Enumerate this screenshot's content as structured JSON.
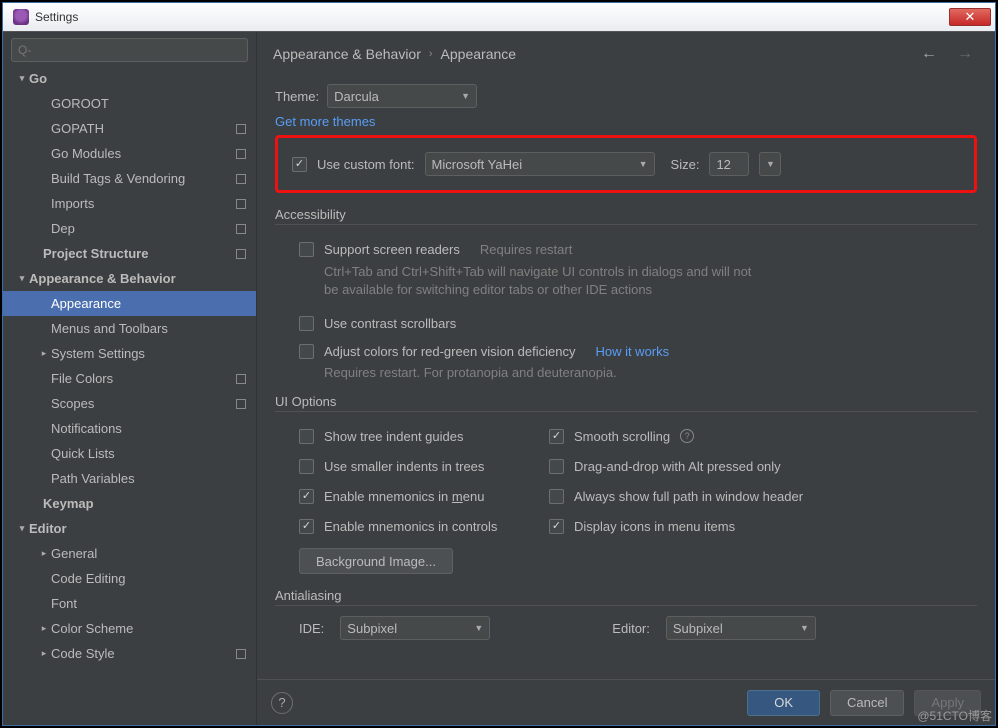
{
  "window": {
    "title": "Settings"
  },
  "search": {
    "placeholder": "Q-"
  },
  "breadcrumb": {
    "parent": "Appearance & Behavior",
    "current": "Appearance"
  },
  "sidebar": [
    {
      "label": "Go",
      "indent": 0,
      "bold": true,
      "chev": "down",
      "badge": false
    },
    {
      "label": "GOROOT",
      "indent": 1,
      "bold": false,
      "chev": "",
      "badge": false
    },
    {
      "label": "GOPATH",
      "indent": 1,
      "bold": false,
      "chev": "",
      "badge": true
    },
    {
      "label": "Go Modules",
      "indent": 1,
      "bold": false,
      "chev": "",
      "badge": true
    },
    {
      "label": "Build Tags & Vendoring",
      "indent": 1,
      "bold": false,
      "chev": "",
      "badge": true
    },
    {
      "label": "Imports",
      "indent": 1,
      "bold": false,
      "chev": "",
      "badge": true
    },
    {
      "label": "Dep",
      "indent": 1,
      "bold": false,
      "chev": "",
      "badge": true
    },
    {
      "label": "Project Structure",
      "indent": 0,
      "bold": true,
      "chev": "",
      "badge": true
    },
    {
      "label": "Appearance & Behavior",
      "indent": 0,
      "bold": true,
      "chev": "down",
      "badge": false
    },
    {
      "label": "Appearance",
      "indent": 1,
      "bold": false,
      "chev": "",
      "badge": false,
      "selected": true
    },
    {
      "label": "Menus and Toolbars",
      "indent": 1,
      "bold": false,
      "chev": "",
      "badge": false
    },
    {
      "label": "System Settings",
      "indent": 1,
      "bold": false,
      "chev": "right",
      "badge": false
    },
    {
      "label": "File Colors",
      "indent": 1,
      "bold": false,
      "chev": "",
      "badge": true
    },
    {
      "label": "Scopes",
      "indent": 1,
      "bold": false,
      "chev": "",
      "badge": true
    },
    {
      "label": "Notifications",
      "indent": 1,
      "bold": false,
      "chev": "",
      "badge": false
    },
    {
      "label": "Quick Lists",
      "indent": 1,
      "bold": false,
      "chev": "",
      "badge": false
    },
    {
      "label": "Path Variables",
      "indent": 1,
      "bold": false,
      "chev": "",
      "badge": false
    },
    {
      "label": "Keymap",
      "indent": 0,
      "bold": true,
      "chev": "",
      "badge": false
    },
    {
      "label": "Editor",
      "indent": 0,
      "bold": true,
      "chev": "down",
      "badge": false
    },
    {
      "label": "General",
      "indent": 1,
      "bold": false,
      "chev": "right",
      "badge": false
    },
    {
      "label": "Code Editing",
      "indent": 1,
      "bold": false,
      "chev": "",
      "badge": false
    },
    {
      "label": "Font",
      "indent": 1,
      "bold": false,
      "chev": "",
      "badge": false
    },
    {
      "label": "Color Scheme",
      "indent": 1,
      "bold": false,
      "chev": "right",
      "badge": false
    },
    {
      "label": "Code Style",
      "indent": 1,
      "bold": false,
      "chev": "right",
      "badge": true
    }
  ],
  "theme": {
    "label": "Theme:",
    "value": "Darcula"
  },
  "get_more_themes": "Get more themes",
  "custom_font": {
    "checkbox_label": "Use custom font:",
    "font": "Microsoft YaHei",
    "size_label": "Size:",
    "size": "12"
  },
  "accessibility": {
    "heading": "Accessibility",
    "screen_readers": "Support screen readers",
    "requires_restart": "Requires restart",
    "note": "Ctrl+Tab and Ctrl+Shift+Tab will navigate UI controls in dialogs and will not be available for switching editor tabs or other IDE actions",
    "contrast": "Use contrast scrollbars",
    "color_deficiency": "Adjust colors for red-green vision deficiency",
    "how_it_works": "How it works",
    "cd_note": "Requires restart. For protanopia and deuteranopia."
  },
  "ui_options": {
    "heading": "UI Options",
    "tree_indent": "Show tree indent guides",
    "smooth_scroll": "Smooth scrolling",
    "smaller_indents": "Use smaller indents in trees",
    "drag_alt": "Drag-and-drop with Alt pressed only",
    "mnemonics_menu_pre": "Enable mnemonics in ",
    "mnemonics_menu_u": "m",
    "mnemonics_menu_post": "enu",
    "full_path": "Always show full path in window header",
    "mnemonics_controls": "Enable mnemonics in controls",
    "icons_menu": "Display icons in menu items",
    "bg_image": "Background Image..."
  },
  "antialiasing": {
    "heading": "Antialiasing",
    "ide_label": "IDE:",
    "ide_value": "Subpixel",
    "editor_label": "Editor:",
    "editor_value": "Subpixel"
  },
  "footer": {
    "ok": "OK",
    "cancel": "Cancel",
    "apply": "Apply"
  },
  "watermark": "@51CTO博客"
}
